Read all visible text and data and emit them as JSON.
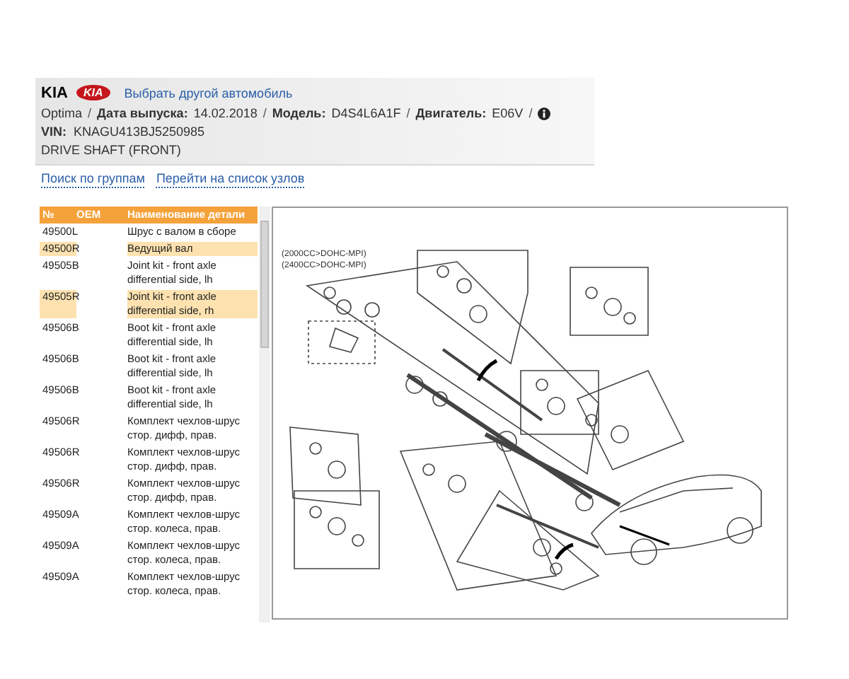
{
  "header": {
    "brand": "KIA",
    "logo_text": "KIA",
    "change_car_link": "Выбрать другой автомобиль",
    "info": [
      {
        "kind": "plain",
        "value": "Optima"
      },
      {
        "kind": "field",
        "label": "Дата выпуска:",
        "value": "14.02.2018"
      },
      {
        "kind": "field",
        "label": "Модель:",
        "value": "D4S4L6A1F"
      },
      {
        "kind": "field",
        "label": "Двигатель:",
        "value": "E06V"
      }
    ],
    "separator": "/",
    "vin_label": "VIN:",
    "vin": "KNAGU413BJ5250985",
    "group_title": "DRIVE SHAFT (FRONT)"
  },
  "links": [
    "Поиск по группам",
    "Перейти на список узлов"
  ],
  "table": {
    "columns": [
      "№",
      "OEM",
      "Наименование детали"
    ],
    "rows": [
      {
        "no": "49500L",
        "name": "Шрус с валом в сборе",
        "selected": false
      },
      {
        "no": "49500R",
        "name": "Ведущий вал",
        "selected": true
      },
      {
        "no": "49505B",
        "name": "Joint kit - front axle differential side, lh",
        "selected": false
      },
      {
        "no": "49505R",
        "name": "Joint kit - front axle differential side, rh",
        "selected": true
      },
      {
        "no": "49506B",
        "name": "Boot kit - front axle differential side, lh",
        "selected": false
      },
      {
        "no": "49506B",
        "name": "Boot kit - front axle differential side, lh",
        "selected": false
      },
      {
        "no": "49506B",
        "name": "Boot kit - front axle differential side, lh",
        "selected": false
      },
      {
        "no": "49506R",
        "name": "Комплект чехлов-шрус стор. дифф, прав.",
        "selected": false
      },
      {
        "no": "49506R",
        "name": "Комплект чехлов-шрус стор. дифф, прав.",
        "selected": false
      },
      {
        "no": "49506R",
        "name": "Комплект чехлов-шрус стор. дифф, прав.",
        "selected": false
      },
      {
        "no": "49509A",
        "name": "Комплект чехлов-шрус стор. колеса, прав.",
        "selected": false
      },
      {
        "no": "49509A",
        "name": "Комплект чехлов-шрус стор. колеса, прав.",
        "selected": false
      },
      {
        "no": "49509A",
        "name": "Комплект чехлов-шрус стор. колеса, прав.",
        "selected": false
      }
    ]
  },
  "diagram": {
    "notes": [
      "(2000CC>DOHC-MPI)",
      "(2400CC>DOHC-MPI)"
    ]
  }
}
